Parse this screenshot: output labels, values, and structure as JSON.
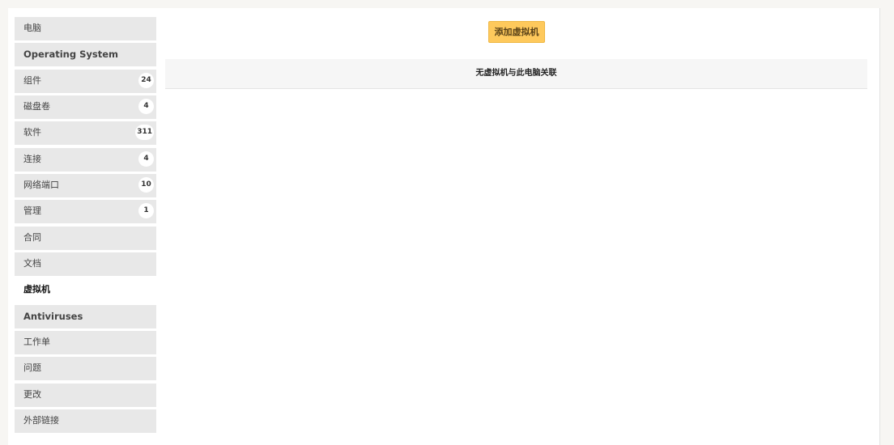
{
  "sidebar": {
    "items": [
      {
        "label": "电脑"
      },
      {
        "label": "Operating System"
      },
      {
        "label": "组件",
        "count": "24"
      },
      {
        "label": "磁盘卷",
        "count": "4"
      },
      {
        "label": "软件",
        "count": "311"
      },
      {
        "label": "连接",
        "count": "4"
      },
      {
        "label": "网络端口",
        "count": "10"
      },
      {
        "label": "管理",
        "count": "1"
      },
      {
        "label": "合同"
      },
      {
        "label": "文档"
      },
      {
        "label": "虚拟机",
        "active": true
      },
      {
        "label": "Antiviruses"
      },
      {
        "label": "工作单"
      },
      {
        "label": "问题"
      },
      {
        "label": "更改"
      },
      {
        "label": "外部链接"
      }
    ]
  },
  "main": {
    "add_button_label": "添加虚拟机",
    "empty_message": "无虚拟机与此电脑关联"
  },
  "colors": {
    "tab_background": "#e8e8e8",
    "active_tab_background": "#ffffff",
    "button_background": "#fec95c",
    "page_background": "#f7f6f3"
  }
}
